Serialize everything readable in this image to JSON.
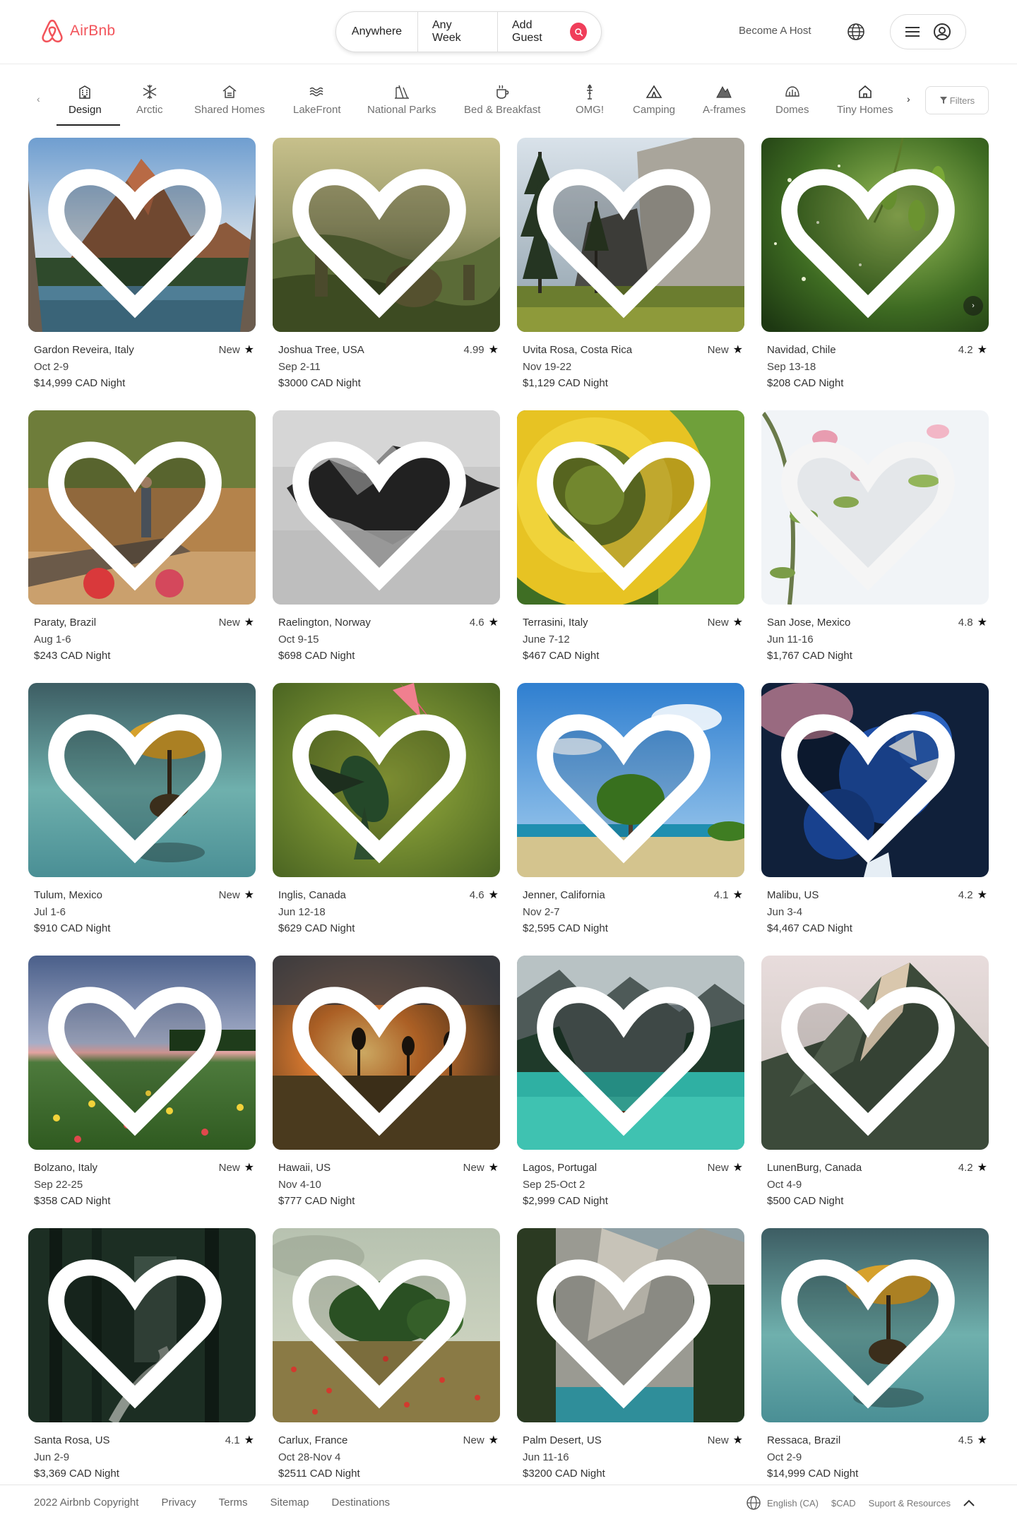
{
  "brand": {
    "name": "AirBnb",
    "color": "#f2545b"
  },
  "search": {
    "where": "Anywhere",
    "when": "Any Week",
    "guests": "Add Guest"
  },
  "header": {
    "host_link": "Become A Host"
  },
  "categories": [
    {
      "label": "Design",
      "icon": "building-icon"
    },
    {
      "label": "Arctic",
      "icon": "snowflake-icon"
    },
    {
      "label": "Shared Homes",
      "icon": "shared-home-icon"
    },
    {
      "label": "LakeFront",
      "icon": "waves-icon"
    },
    {
      "label": "National Parks",
      "icon": "park-icon"
    },
    {
      "label": "Bed & Breakfast",
      "icon": "coffee-icon"
    },
    {
      "label": "OMG!",
      "icon": "rocket-icon"
    },
    {
      "label": "Camping",
      "icon": "tent-icon"
    },
    {
      "label": "A-frames",
      "icon": "a-frame-icon"
    },
    {
      "label": "Domes",
      "icon": "dome-icon"
    },
    {
      "label": "Tiny Homes",
      "icon": "tiny-home-icon"
    }
  ],
  "filters_label": "Filters",
  "listings": [
    {
      "location": "Gardon Reveira, Italy",
      "rating": "New",
      "dates": "Oct 2-9",
      "price": "$14,999 CAD Night"
    },
    {
      "location": "Joshua Tree, USA",
      "rating": "4.99",
      "dates": "Sep 2-11",
      "price": "$3000 CAD Night"
    },
    {
      "location": "Uvita Rosa, Costa Rica",
      "rating": "New",
      "dates": "Nov 19-22",
      "price": "$1,129 CAD Night"
    },
    {
      "location": "Navidad, Chile",
      "rating": "4.2",
      "dates": "Sep 13-18",
      "price": "$208 CAD Night"
    },
    {
      "location": "Paraty, Brazil",
      "rating": "New",
      "dates": "Aug 1-6",
      "price": "$243 CAD Night"
    },
    {
      "location": "Raelington, Norway",
      "rating": "4.6",
      "dates": "Oct 9-15",
      "price": "$698 CAD Night"
    },
    {
      "location": "Terrasini, Italy",
      "rating": "New",
      "dates": "June 7-12",
      "price": "$467 CAD Night"
    },
    {
      "location": "San Jose, Mexico",
      "rating": "4.8",
      "dates": "Jun 11-16",
      "price": "$1,767 CAD Night"
    },
    {
      "location": "Tulum, Mexico",
      "rating": "New",
      "dates": "Jul 1-6",
      "price": "$910 CAD Night"
    },
    {
      "location": "Inglis, Canada",
      "rating": "4.6",
      "dates": "Jun 12-18",
      "price": "$629 CAD Night"
    },
    {
      "location": "Jenner, California",
      "rating": "4.1",
      "dates": "Nov 2-7",
      "price": "$2,595 CAD Night"
    },
    {
      "location": "Malibu, US",
      "rating": "4.2",
      "dates": "Jun 3-4",
      "price": "$4,467 CAD Night"
    },
    {
      "location": "Bolzano, Italy",
      "rating": "New",
      "dates": "Sep 22-25",
      "price": "$358 CAD Night"
    },
    {
      "location": "Hawaii, US",
      "rating": "New",
      "dates": "Nov 4-10",
      "price": "$777 CAD Night"
    },
    {
      "location": "Lagos, Portugal",
      "rating": "New",
      "dates": "Sep 25-Oct 2",
      "price": "$2,999 CAD Night"
    },
    {
      "location": "LunenBurg, Canada",
      "rating": "4.2",
      "dates": "Oct 4-9",
      "price": "$500 CAD Night"
    },
    {
      "location": "Santa Rosa, US",
      "rating": "4.1",
      "dates": "Jun 2-9",
      "price": "$3,369 CAD Night"
    },
    {
      "location": "Carlux, France",
      "rating": "New",
      "dates": "Oct 28-Nov 4",
      "price": "$2511 CAD Night"
    },
    {
      "location": "Palm Desert, US",
      "rating": "New",
      "dates": "Jun 11-16",
      "price": "$3200 CAD Night"
    },
    {
      "location": "Ressaca, Brazil",
      "rating": "4.5",
      "dates": "Oct 2-9",
      "price": "$14,999 CAD Night"
    }
  ],
  "footer": {
    "copyright": "2022 Airbnb Copyright",
    "links": [
      "Privacy",
      "Terms",
      "Sitemap",
      "Destinations"
    ],
    "language": "English (CA)",
    "currency": "$CAD",
    "support": "Suport & Resources"
  }
}
